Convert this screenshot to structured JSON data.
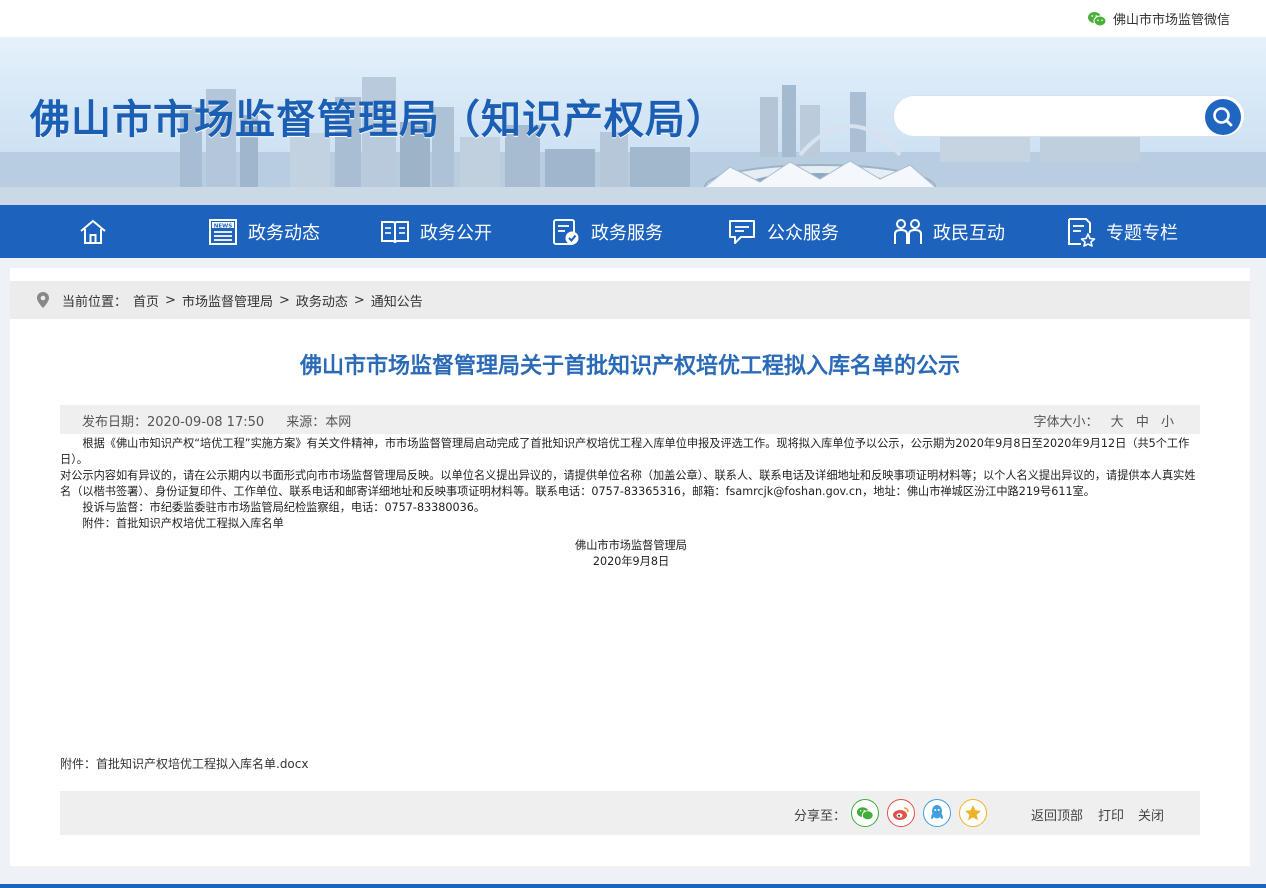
{
  "topbar": {
    "wechat_label": "佛山市市场监管微信"
  },
  "header": {
    "title": "佛山市市场监督管理局（知识产权局）",
    "search_placeholder": ""
  },
  "nav": {
    "items": [
      {
        "label": "政务动态"
      },
      {
        "label": "政务公开"
      },
      {
        "label": "政务服务"
      },
      {
        "label": "公众服务"
      },
      {
        "label": "政民互动"
      },
      {
        "label": "专题专栏"
      }
    ]
  },
  "breadcrumb": {
    "prefix": "当前位置：",
    "items": [
      "首页",
      "市场监督管理局",
      "政务动态",
      "通知公告"
    ],
    "separator": ">"
  },
  "article": {
    "title": "佛山市市场监督管理局关于首批知识产权培优工程拟入库名单的公示",
    "publish_label": "发布日期：2020-09-08 17:50",
    "source_label": "来源：本网",
    "font_size_label": "字体大小：",
    "font_sizes": [
      "大",
      "中",
      "小"
    ],
    "paragraphs": [
      "　　根据《佛山市知识产权“培优工程”实施方案》有关文件精神，市市场监督管理局启动完成了首批知识产权培优工程入库单位申报及评选工作。现将拟入库单位予以公示，公示期为2020年9月8日至2020年9月12日（共5个工作日）。",
      "对公示内容如有异议的，请在公示期内以书面形式向市市场监督管理局反映。以单位名义提出异议的，请提供单位名称（加盖公章）、联系人、联系电话及详细地址和反映事项证明材料等；以个人名义提出异议的，请提供本人真实姓名（以楷书签署）、身份证复印件、工作单位、联系电话和邮寄详细地址和反映事项证明材料等。联系电话：0757-83365316，邮箱：fsamrcjk@foshan.gov.cn，地址：佛山市禅城区汾江中路219号611室。",
      "　　投诉与监督：市纪委监委驻市市场监管局纪检监察组，电话：0757-83380036。",
      "　　附件：首批知识产权培优工程拟入库名单"
    ],
    "signature": "佛山市市场监督管理局",
    "date": "2020年9月8日",
    "attachment": "附件：首批知识产权培优工程拟入库名单.docx"
  },
  "share": {
    "label": "分享至：",
    "buttons": [
      {
        "icon": "wechat-icon",
        "color": "#3fae3a"
      },
      {
        "icon": "weibo-icon",
        "color": "#e4504b"
      },
      {
        "icon": "qq-icon",
        "color": "#3f9fe0"
      },
      {
        "icon": "qzone-icon",
        "color": "#f0b12a"
      }
    ],
    "back_top": "返回顶部",
    "print": "打印",
    "close": "关闭"
  },
  "colors": {
    "primary": "#1d63bd",
    "title_blue": "#2a6ab7"
  }
}
